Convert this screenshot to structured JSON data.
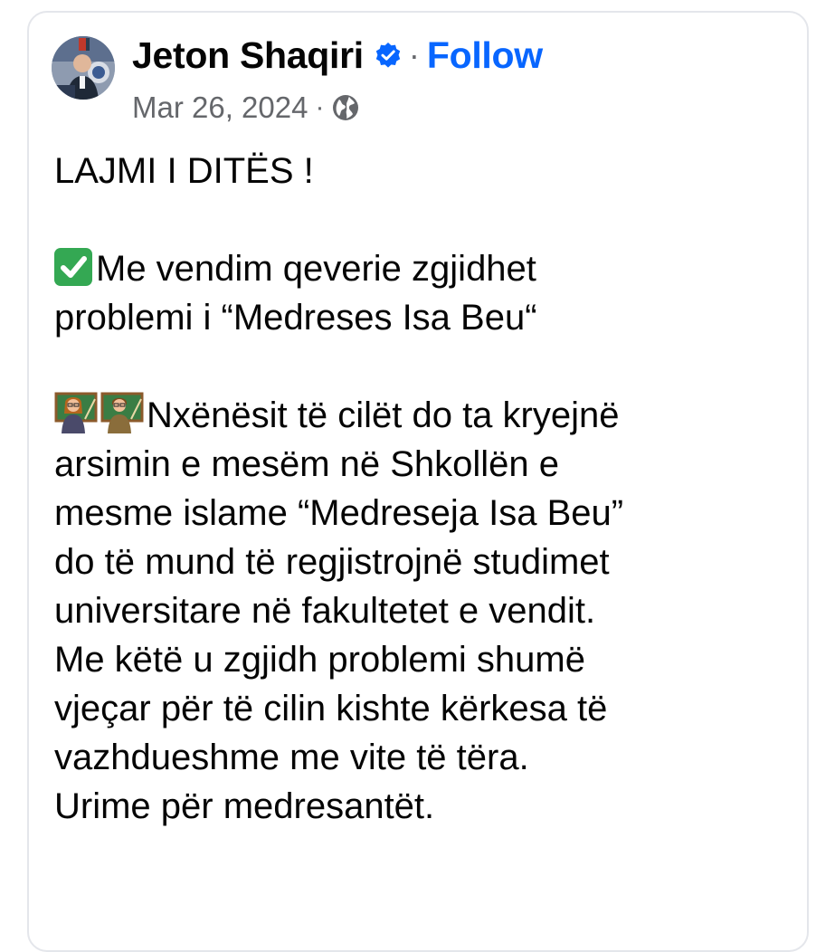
{
  "post": {
    "author_name": "Jeton Shaqiri",
    "follow_label": "Follow",
    "separator": "·",
    "date": "Mar 26, 2024",
    "icons": {
      "avatar": "profile-photo",
      "verified": "verified-badge-icon",
      "audience": "globe-icon"
    },
    "colors": {
      "follow": "#0866ff",
      "verified": "#0866ff",
      "meta": "#65676b",
      "text": "#050505"
    },
    "body": {
      "headline": "LAJMI I DITËS !",
      "check_emoji": "white-check-mark",
      "para1_line1": "Me vendim qeverie zgjidhet",
      "para1_line2": "problemi i “Medreses Isa Beu“",
      "teacher_emojis": [
        "woman-teacher",
        "man-teacher"
      ],
      "para2_lines": [
        "Nxënësit të cilët do ta kryejnë",
        "arsimin e mesëm në Shkollën e",
        "mesme islame “Medreseja Isa Beu”",
        "do të mund të regjistrojnë studimet",
        "universitare në fakultetet e vendit.",
        "Me këtë u zgjidh problemi shumë",
        "vjeçar për të cilin kishte kërkesa të",
        "vazhdueshme me vite të tëra.",
        "Urime për medresantët."
      ]
    }
  }
}
